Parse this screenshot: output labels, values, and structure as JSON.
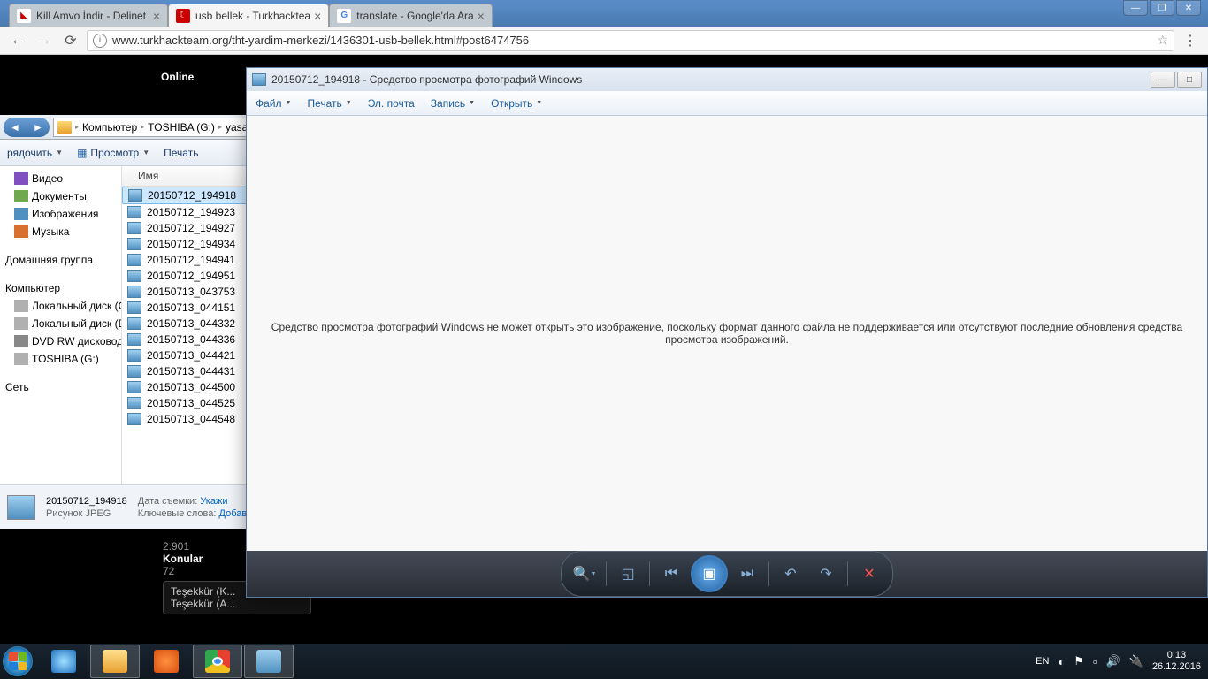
{
  "browser": {
    "tabs": [
      {
        "title": "Kill Amvo İndir - Delinet",
        "active": false
      },
      {
        "title": "usb bellek - Turkhacktea",
        "active": true
      },
      {
        "title": "translate - Google'da Ara",
        "active": false
      }
    ],
    "url": "www.turkhackteam.org/tht-yardim-merkezi/1436301-usb-bellek.html#post6474756"
  },
  "forum": {
    "online": "Online",
    "stat1": "2.901",
    "konular_label": "Konular",
    "konular_val": "72",
    "tesekkur1": "Teşekkür (K...",
    "tesekkur2": "Teşekkür (A..."
  },
  "explorer": {
    "breadcrumb": [
      "Компьютер",
      "TOSHIBA (G:)",
      "yasar"
    ],
    "toolbar": {
      "organize": "рядочить",
      "view": "Просмотр",
      "print": "Печать"
    },
    "nav": {
      "video": "Видео",
      "documents": "Документы",
      "images": "Изображения",
      "music": "Музыка",
      "homegroup": "Домашняя группа",
      "computer": "Компьютер",
      "localc": "Локальный диск (C:)",
      "locald": "Локальный диск (D:)",
      "dvd": "DVD RW дисковод (E",
      "toshiba": "TOSHIBA (G:)",
      "network": "Сеть"
    },
    "col_name": "Имя",
    "files": [
      "20150712_194918",
      "20150712_194923",
      "20150712_194927",
      "20150712_194934",
      "20150712_194941",
      "20150712_194951",
      "20150713_043753",
      "20150713_044151",
      "20150713_044332",
      "20150713_044336",
      "20150713_044421",
      "20150713_044431",
      "20150713_044500",
      "20150713_044525",
      "20150713_044548"
    ],
    "details": {
      "name": "20150712_194918",
      "type": "Рисунок JPEG",
      "date_label": "Дата съемки:",
      "date_val": "Укажи",
      "tags_label": "Ключевые слова:",
      "tags_val": "Добав"
    }
  },
  "photoviewer": {
    "title": "20150712_194918 - Средство просмотра фотографий Windows",
    "menu": {
      "file": "Файл",
      "print": "Печать",
      "email": "Эл. почта",
      "burn": "Запись",
      "open": "Открыть"
    },
    "error": "Средство просмотра фотографий Windows не может открыть это изображение, поскольку формат данного файла не поддерживается или отсутствуют последние обновления средства просмотра изображений."
  },
  "taskbar": {
    "lang": "EN",
    "time": "0:13",
    "date": "26.12.2016"
  }
}
